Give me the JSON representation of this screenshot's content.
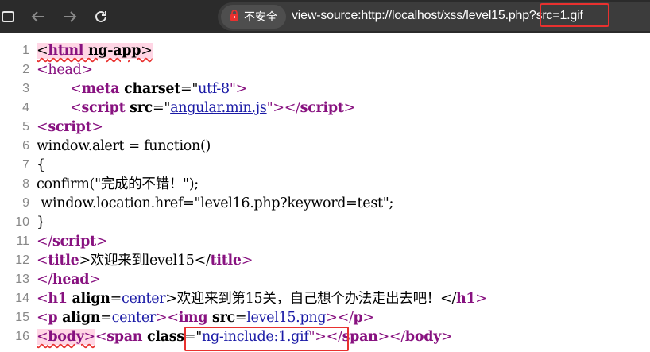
{
  "browser": {
    "security_label": "不安全",
    "url": "view-source:http://localhost/xss/level15.php?src=1.gif",
    "icons": [
      "sidebar-icon",
      "back-arrow-icon",
      "forward-arrow-icon",
      "reload-icon",
      "not-secure-icon"
    ],
    "highlight_color": "#e8312f"
  },
  "source": {
    "lines": [
      {
        "num": "1"
      },
      {
        "num": "2",
        "t1": "<head>"
      },
      {
        "num": "3",
        "t1": "        <",
        "t2": "meta",
        "t3": " charset",
        "t4": "=\"",
        "t5": "utf-8",
        "t6": "\">"
      },
      {
        "num": "4",
        "t1": "        <",
        "t2": "script",
        "t3": " src",
        "t4": "=\"",
        "t5": "angular.min.js",
        "t6": "\"></",
        "t7": "script",
        "t8": ">"
      },
      {
        "num": "5",
        "t1": "<",
        "t2": "script",
        "t3": ">"
      },
      {
        "num": "6",
        "t1": "window.alert = function()"
      },
      {
        "num": "7",
        "t1": "{"
      },
      {
        "num": "8",
        "t1": "confirm(\"完成的不错！\");"
      },
      {
        "num": "9",
        "t1": " window.location.href=\"level16.php?keyword=test\";"
      },
      {
        "num": "10",
        "t1": "}"
      },
      {
        "num": "11",
        "t1": "</",
        "t2": "script",
        "t3": ">"
      },
      {
        "num": "12",
        "t1": "<",
        "t2": "title",
        "t3": ">欢迎来到level15</",
        "t4": "title",
        "t5": ">"
      },
      {
        "num": "13",
        "t1": "</",
        "t2": "head",
        "t3": ">"
      },
      {
        "num": "14",
        "t1": "<",
        "t2": "h1",
        "t3": " align",
        "t4": "=",
        "t5": "center",
        "t6": ">欢迎来到第15关，自己想个办法走出去吧！</",
        "t7": "h1",
        "t8": ">"
      },
      {
        "num": "15",
        "t1": "<",
        "t2": "p",
        "t3": " align",
        "t4": "=",
        "t5": "center",
        "t6": "><",
        "t7": "img",
        "t8": " src",
        "t9": "=",
        "t10": "level15.png",
        "t11": "></",
        "t12": "p",
        "t13": ">"
      },
      {
        "num": "16",
        "t1": "<",
        "t2": "body",
        "t3": ">",
        "t4": "<",
        "t5": "span",
        "t6": " class",
        "t7": "=\"",
        "t8": "ng-include:1.gif",
        "t9": "\"></",
        "t10": "span",
        "t11": "></",
        "t12": "body",
        "t13": ">"
      }
    ],
    "line1": {
      "open": "<",
      "tag": "html",
      "attr": " ng-app",
      "close": ">"
    }
  }
}
